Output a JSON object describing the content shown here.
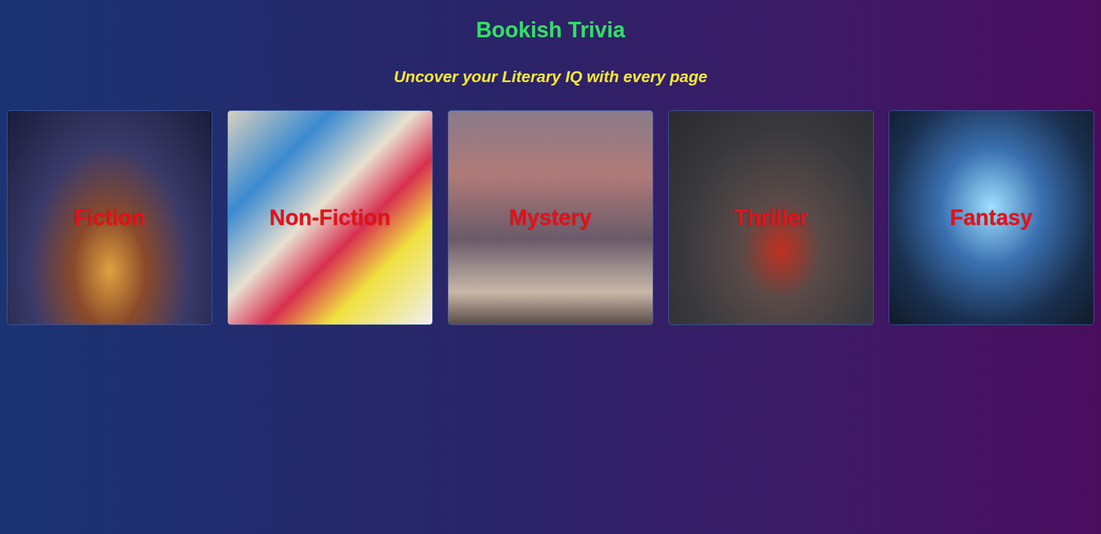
{
  "title": "Bookish Trivia",
  "subtitle": "Uncover your Literary IQ with every page",
  "categories": [
    {
      "label": "Fiction"
    },
    {
      "label": "Non-Fiction"
    },
    {
      "label": "Mystery"
    },
    {
      "label": "Thriller"
    },
    {
      "label": "Fantasy"
    }
  ]
}
